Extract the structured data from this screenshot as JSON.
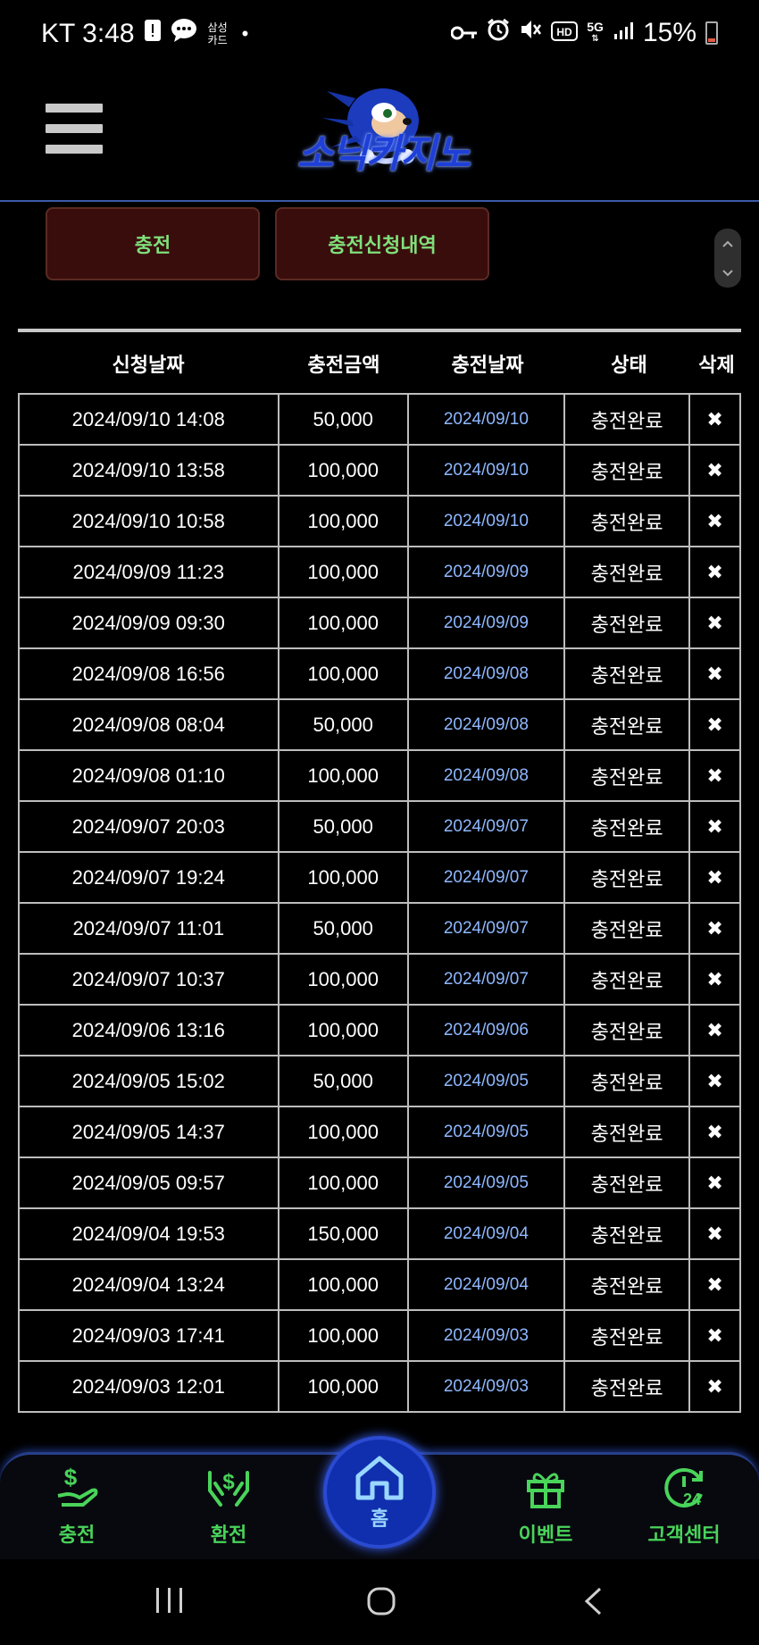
{
  "status_bar": {
    "carrier_time": "KT 3:48",
    "notif_small": [
      "삼성",
      "카드"
    ],
    "dot": "•",
    "network": "5G",
    "battery": "15%"
  },
  "header": {
    "logo_text": "소닉카지노"
  },
  "tabs": {
    "charge": "충전",
    "history": "충전신청내역"
  },
  "table": {
    "headers": [
      "신청날짜",
      "충전금액",
      "충전날짜",
      "상태",
      "삭제"
    ],
    "rows": [
      {
        "req": "2024/09/10 14:08",
        "amount": "50,000",
        "date": "2024/09/10",
        "status": "충전완료"
      },
      {
        "req": "2024/09/10 13:58",
        "amount": "100,000",
        "date": "2024/09/10",
        "status": "충전완료"
      },
      {
        "req": "2024/09/10 10:58",
        "amount": "100,000",
        "date": "2024/09/10",
        "status": "충전완료"
      },
      {
        "req": "2024/09/09 11:23",
        "amount": "100,000",
        "date": "2024/09/09",
        "status": "충전완료"
      },
      {
        "req": "2024/09/09 09:30",
        "amount": "100,000",
        "date": "2024/09/09",
        "status": "충전완료"
      },
      {
        "req": "2024/09/08 16:56",
        "amount": "100,000",
        "date": "2024/09/08",
        "status": "충전완료"
      },
      {
        "req": "2024/09/08 08:04",
        "amount": "50,000",
        "date": "2024/09/08",
        "status": "충전완료"
      },
      {
        "req": "2024/09/08 01:10",
        "amount": "100,000",
        "date": "2024/09/08",
        "status": "충전완료"
      },
      {
        "req": "2024/09/07 20:03",
        "amount": "50,000",
        "date": "2024/09/07",
        "status": "충전완료"
      },
      {
        "req": "2024/09/07 19:24",
        "amount": "100,000",
        "date": "2024/09/07",
        "status": "충전완료"
      },
      {
        "req": "2024/09/07 11:01",
        "amount": "50,000",
        "date": "2024/09/07",
        "status": "충전완료"
      },
      {
        "req": "2024/09/07 10:37",
        "amount": "100,000",
        "date": "2024/09/07",
        "status": "충전완료"
      },
      {
        "req": "2024/09/06 13:16",
        "amount": "100,000",
        "date": "2024/09/06",
        "status": "충전완료"
      },
      {
        "req": "2024/09/05 15:02",
        "amount": "50,000",
        "date": "2024/09/05",
        "status": "충전완료"
      },
      {
        "req": "2024/09/05 14:37",
        "amount": "100,000",
        "date": "2024/09/05",
        "status": "충전완료"
      },
      {
        "req": "2024/09/05 09:57",
        "amount": "100,000",
        "date": "2024/09/05",
        "status": "충전완료"
      },
      {
        "req": "2024/09/04 19:53",
        "amount": "150,000",
        "date": "2024/09/04",
        "status": "충전완료"
      },
      {
        "req": "2024/09/04 13:24",
        "amount": "100,000",
        "date": "2024/09/04",
        "status": "충전완료"
      },
      {
        "req": "2024/09/03 17:41",
        "amount": "100,000",
        "date": "2024/09/03",
        "status": "충전완료"
      },
      {
        "req": "2024/09/03 12:01",
        "amount": "100,000",
        "date": "2024/09/03",
        "status": "충전완료"
      }
    ],
    "delete_glyph": "✖"
  },
  "bottom_nav": {
    "charge": "충전",
    "exchange": "환전",
    "home": "홈",
    "event": "이벤트",
    "support": "고객센터",
    "support_badge": "24"
  },
  "colors": {
    "accent_green": "#49d45a",
    "date_blue": "#8fb8ff",
    "home_blue": "#0f2fae"
  }
}
